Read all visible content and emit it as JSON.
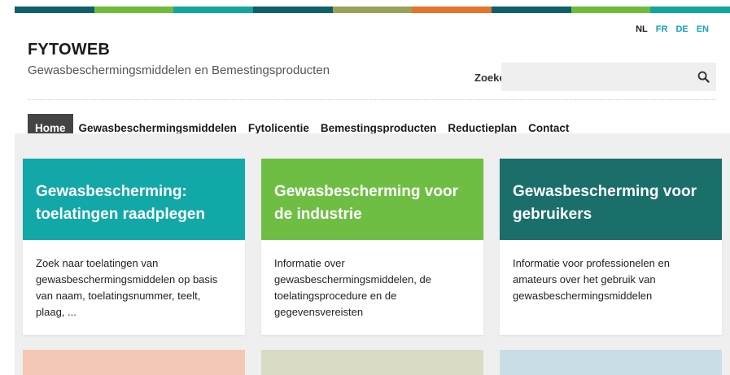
{
  "colors": {
    "stripe": [
      "#0f5f68",
      "#6ebd3a",
      "#13a6a0",
      "#0f5f68",
      "#9ba15a",
      "#e4742a",
      "#0f5f68",
      "#6ebd3a",
      "#13a6a0"
    ],
    "card_heads": [
      "#13a8a8",
      "#6fbe44",
      "#1a6f6a"
    ],
    "bottom_cards": [
      "#f2c8b4",
      "#d9dbc4",
      "#c8dde6"
    ],
    "nav_active_bg": "#444444",
    "lang_link": "#15a0c0"
  },
  "header": {
    "site_title": "FYTOWEB",
    "site_subtitle": "Gewasbeschermingsmiddelen en Bemestingsproducten",
    "languages": [
      {
        "code": "NL",
        "active": true
      },
      {
        "code": "FR",
        "active": false
      },
      {
        "code": "DE",
        "active": false
      },
      {
        "code": "EN",
        "active": false
      }
    ],
    "search": {
      "label": "Zoeken",
      "placeholder": "",
      "value": "",
      "icon": "search-icon"
    }
  },
  "nav": {
    "items": [
      {
        "label": "Home",
        "active": true
      },
      {
        "label": "Gewasbeschermingsmiddelen",
        "active": false
      },
      {
        "label": "Fytolicentie",
        "active": false
      },
      {
        "label": "Bemestingsproducten",
        "active": false
      },
      {
        "label": "Reductieplan",
        "active": false
      },
      {
        "label": "Contact",
        "active": false
      }
    ]
  },
  "cards": [
    {
      "title": "Gewasbescherming: toelatingen raadplegen",
      "body": "Zoek naar toelatingen van gewasbeschermingsmiddelen op basis van naam, toelatingsnummer, teelt, plaag, ..."
    },
    {
      "title": "Gewasbescherming voor de industrie",
      "body": "Informatie over gewasbeschermingsmiddelen, de toelatingsprocedure en de gegevensvereisten"
    },
    {
      "title": "Gewasbescherming voor gebruikers",
      "body": "Informatie voor professionelen en amateurs over het gebruik van gewasbeschermingsmiddelen"
    }
  ]
}
